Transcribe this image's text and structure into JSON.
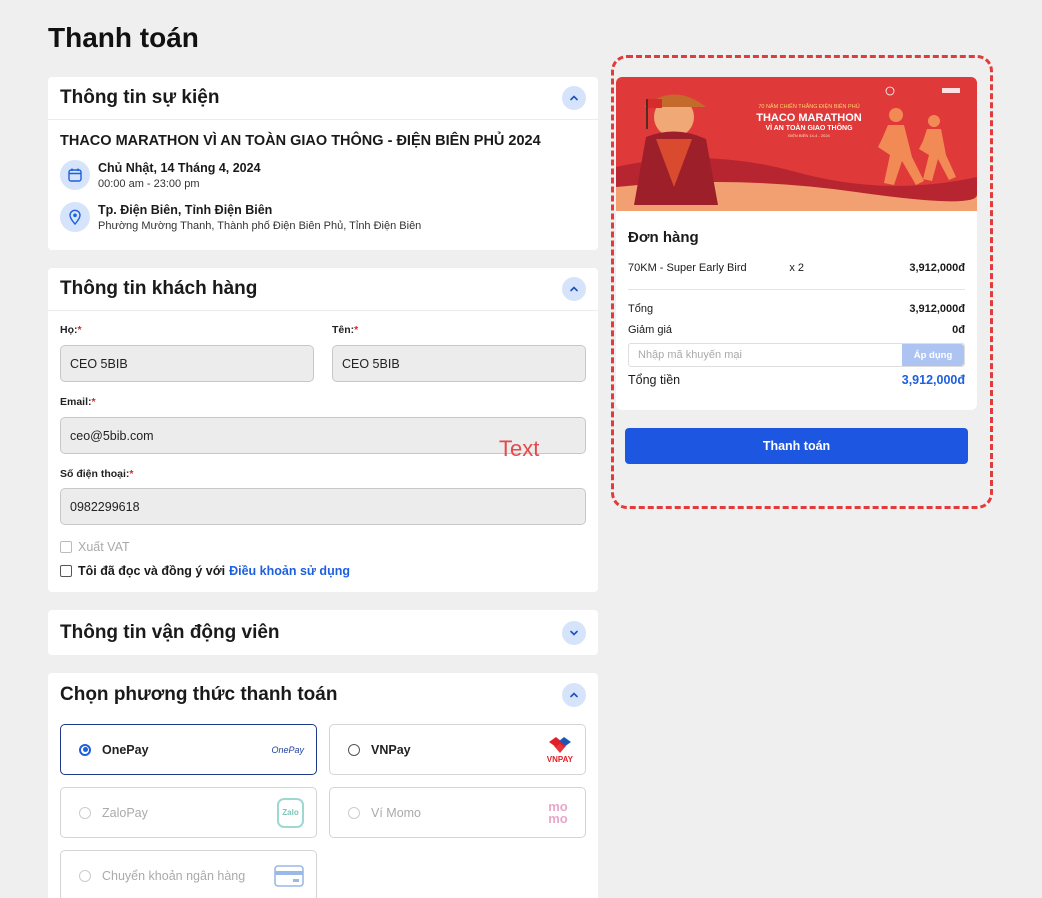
{
  "page": {
    "title": "Thanh toán"
  },
  "event": {
    "section_title": "Thông tin sự kiện",
    "name": "THACO MARATHON VÌ AN TOÀN GIAO THÔNG - ĐIỆN BIÊN PHỦ 2024",
    "date": "Chủ Nhật, 14 Tháng 4, 2024",
    "time": "00:00 am - 23:00 pm",
    "place": "Tp. Điện Biên, Tỉnh Điện Biên",
    "address": "Phường Mường Thanh, Thành phố Điện Biên Phủ, Tỉnh Điện Biên"
  },
  "customer": {
    "section_title": "Thông tin khách hàng",
    "last_name_label": "Họ:",
    "last_name_value": "CEO 5BIB",
    "first_name_label": "Tên:",
    "first_name_value": "CEO 5BIB",
    "email_label": "Email:",
    "email_value": "ceo@5bib.com",
    "phone_label": "Số điện thoại:",
    "phone_value": "0982299618",
    "required_mark": "*",
    "vat_label": "Xuất VAT",
    "terms_prefix": "Tôi đã đọc và đồng ý với",
    "terms_link": "Điều khoản sử dụng",
    "overlay_text": "Text"
  },
  "athlete": {
    "section_title": "Thông tin vận động viên"
  },
  "payment": {
    "section_title": "Chọn phương thức thanh toán",
    "methods": [
      {
        "label": "OnePay",
        "logo": "OnePay",
        "selected": true,
        "enabled": true
      },
      {
        "label": "VNPay",
        "logo": "VNPAY",
        "selected": false,
        "enabled": true
      },
      {
        "label": "ZaloPay",
        "logo": "Zalo",
        "selected": false,
        "enabled": false
      },
      {
        "label": "Ví Momo",
        "logo": "mo mo",
        "selected": false,
        "enabled": false
      },
      {
        "label": "Chuyển khoản ngân hàng",
        "logo": "bank-card-icon",
        "selected": false,
        "enabled": false
      }
    ]
  },
  "banner": {
    "line1": "70 NĂM CHIẾN THẮNG ĐIỆN BIÊN PHỦ",
    "line2": "THACO MARATHON",
    "line3": "VÌ AN TOÀN GIAO THÔNG",
    "line4": "ĐIỆN BIÊN 14-4 - 2024"
  },
  "order": {
    "title": "Đơn hàng",
    "item_name": "70KM - Super Early Bird",
    "item_qty": "x 2",
    "item_price": "3,912,000đ",
    "subtotal_label": "Tổng",
    "subtotal_value": "3,912,000đ",
    "discount_label": "Giảm giá",
    "discount_value": "0đ",
    "promo_placeholder": "Nhập mã khuyến mại",
    "promo_button": "Áp dụng",
    "total_label": "Tổng tiền",
    "total_value": "3,912,000đ",
    "pay_button": "Thanh toán"
  },
  "colors": {
    "accent": "#1d56e0",
    "dashed": "#e23b3b",
    "banner_red": "#e0393a"
  }
}
